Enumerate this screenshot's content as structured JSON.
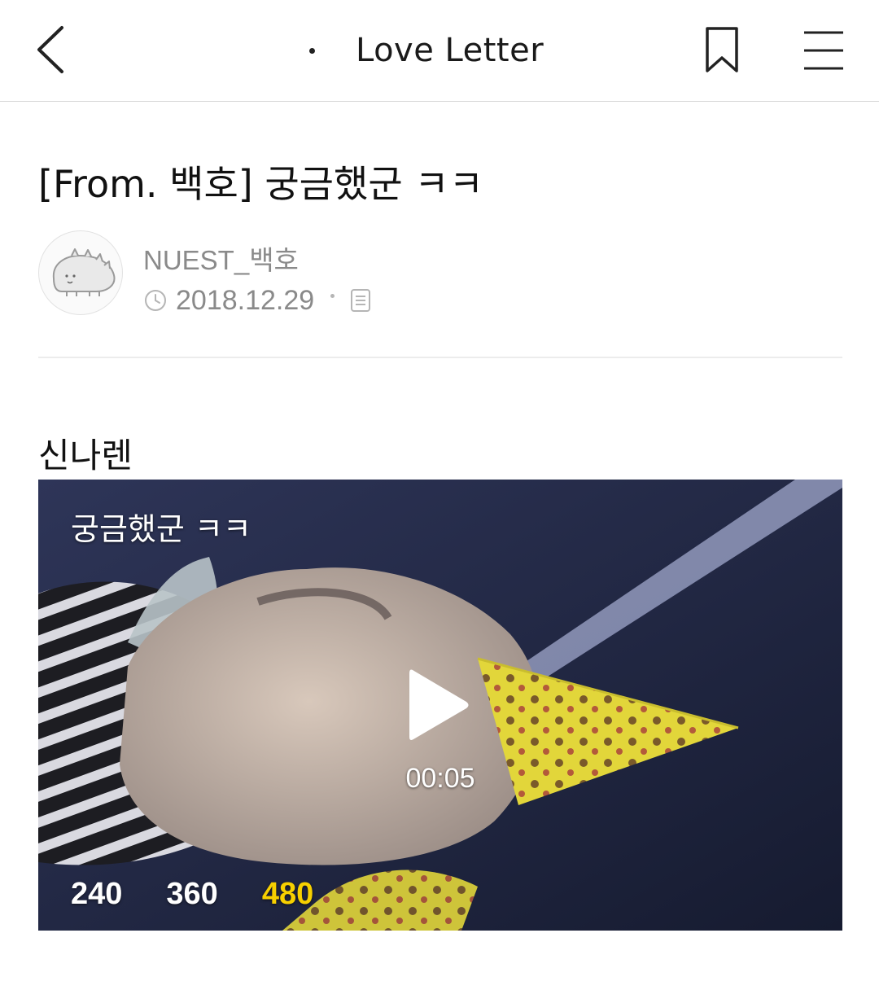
{
  "header": {
    "title": "Love Letter",
    "back_icon": "chevron-left-icon",
    "bookmark_icon": "bookmark-icon",
    "menu_icon": "hamburger-menu-icon"
  },
  "post": {
    "title": "[From. 백호] 궁금했군 ㅋㅋ",
    "author": "NUEST_백호",
    "date": "2018.12.29",
    "clock_icon": "clock-icon",
    "doc_icon": "document-icon"
  },
  "content": {
    "text": "신나렌",
    "video": {
      "caption": "궁금했군 ㅋㅋ",
      "duration": "00:05",
      "play_icon": "play-icon",
      "qualities": [
        {
          "label": "240",
          "active": false
        },
        {
          "label": "360",
          "active": false
        },
        {
          "label": "480",
          "active": true
        }
      ],
      "active_color": "#f7d000"
    }
  }
}
